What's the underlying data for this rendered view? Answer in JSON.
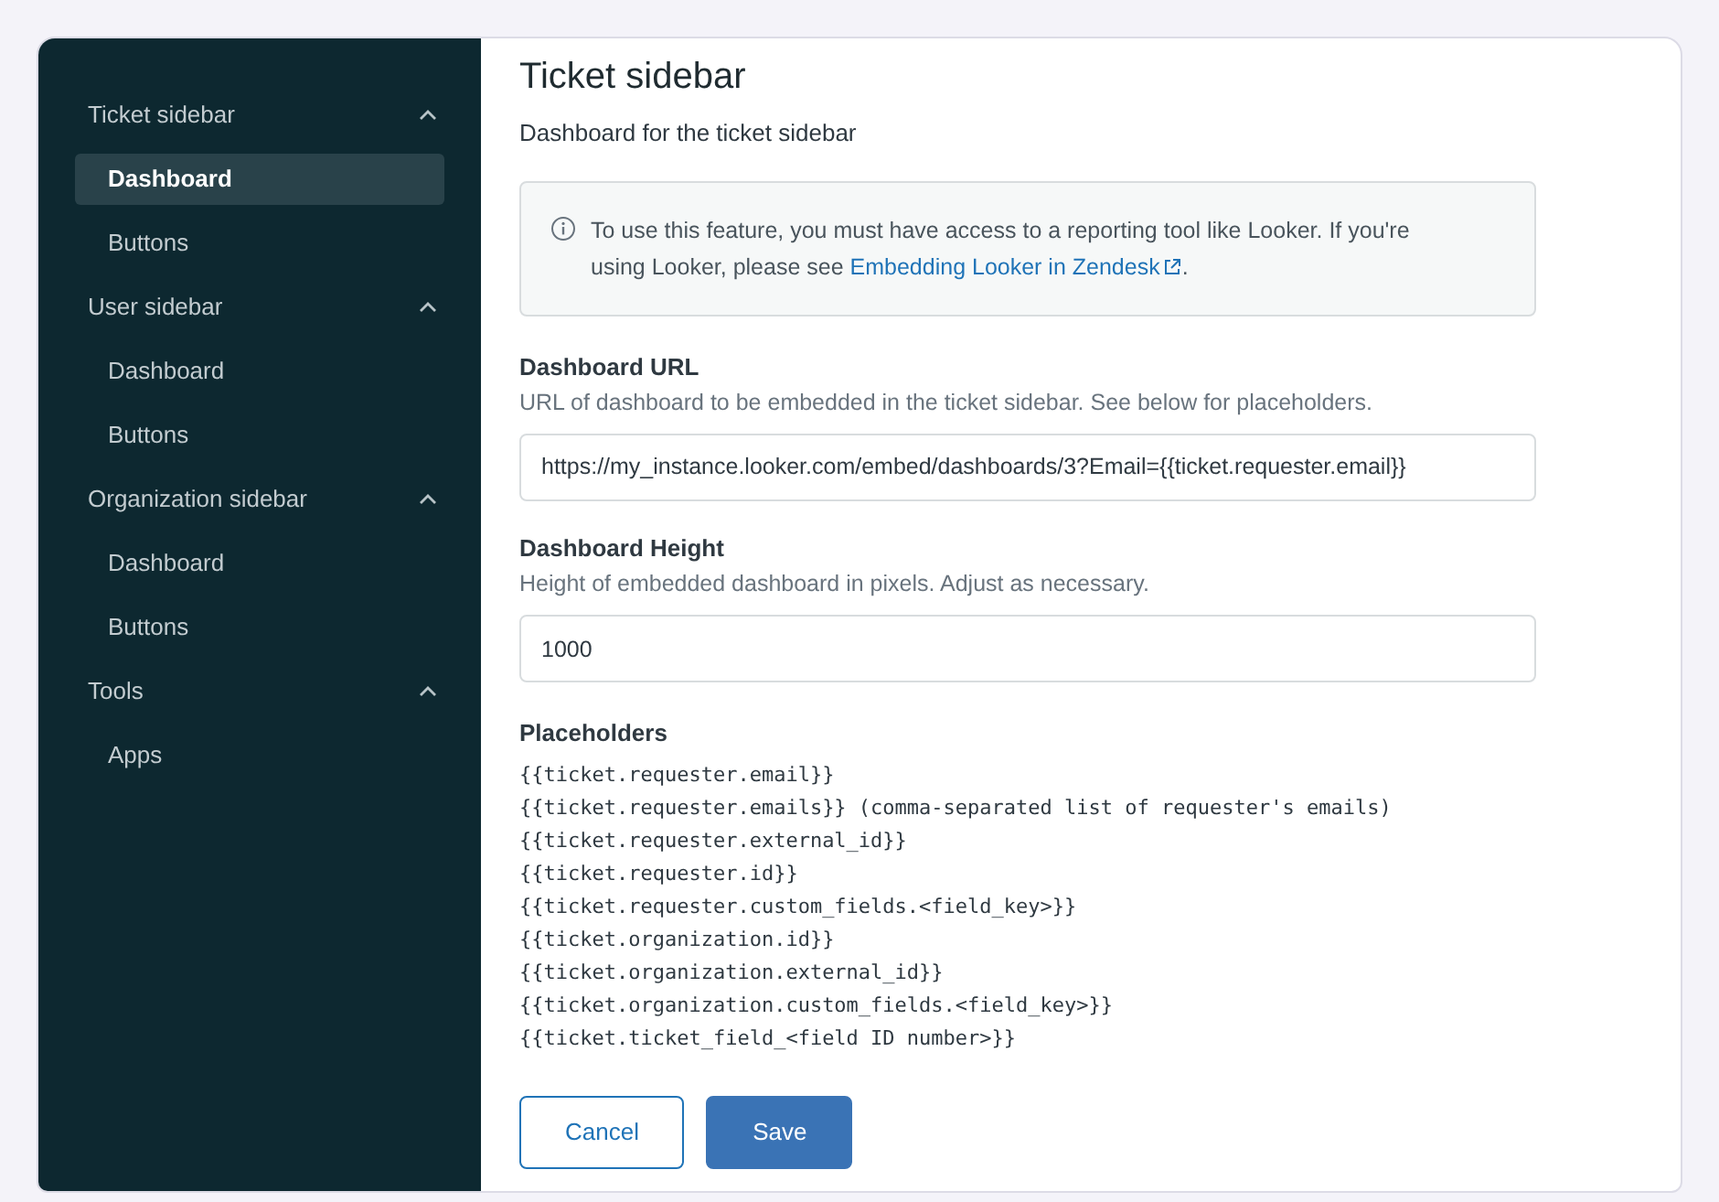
{
  "sidebar": {
    "sections": [
      {
        "label": "Ticket sidebar",
        "expanded": true,
        "items": [
          {
            "label": "Dashboard",
            "selected": true
          },
          {
            "label": "Buttons",
            "selected": false
          }
        ]
      },
      {
        "label": "User sidebar",
        "expanded": true,
        "items": [
          {
            "label": "Dashboard",
            "selected": false
          },
          {
            "label": "Buttons",
            "selected": false
          }
        ]
      },
      {
        "label": "Organization sidebar",
        "expanded": true,
        "items": [
          {
            "label": "Dashboard",
            "selected": false
          },
          {
            "label": "Buttons",
            "selected": false
          }
        ]
      },
      {
        "label": "Tools",
        "expanded": true,
        "items": [
          {
            "label": "Apps",
            "selected": false
          }
        ]
      }
    ]
  },
  "main": {
    "title": "Ticket sidebar",
    "subtitle": "Dashboard for the ticket sidebar",
    "notice": {
      "text": "To use this feature, you must have access to a reporting tool like Looker. If you're using Looker, please see",
      "link": "Embedding Looker in Zendesk",
      "after": "."
    },
    "fields": [
      {
        "label": "Dashboard URL",
        "hint": "URL of dashboard to be embedded in the ticket sidebar. See below for placeholders.",
        "value": "https://my_instance.looker.com/embed/dashboards/3?Email={{ticket.requester.email}}"
      },
      {
        "label": "Dashboard Height",
        "hint": "Height of embedded dashboard in pixels. Adjust as necessary.",
        "value": "1000"
      }
    ],
    "placeholders": {
      "title": "Placeholders",
      "lines": [
        "{{ticket.requester.email}}",
        "{{ticket.requester.emails}} (comma-separated list of requester's emails)",
        "{{ticket.requester.external_id}}",
        "{{ticket.requester.id}}",
        "{{ticket.requester.custom_fields.<field_key>}}",
        "{{ticket.organization.id}}",
        "{{ticket.organization.external_id}}",
        "{{ticket.organization.custom_fields.<field_key>}}",
        "{{ticket.ticket_field_<field ID number>}}"
      ]
    },
    "buttons": [
      {
        "label": "Cancel",
        "kind": "secondary"
      },
      {
        "label": "Save",
        "kind": "primary"
      }
    ]
  }
}
